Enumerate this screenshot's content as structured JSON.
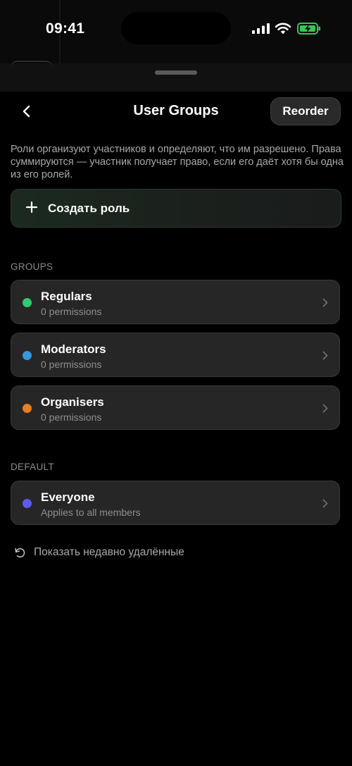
{
  "status_bar": {
    "time": "09:41"
  },
  "header": {
    "title": "User Groups",
    "reorder_label": "Reorder"
  },
  "description": "Роли организуют участников и определяют, что им разрешено. Права суммируются — участник получает право, если его даёт хотя бы одна из его ролей.",
  "create_role_label": "Создать роль",
  "sections": {
    "groups_title": "GROUPS",
    "default_title": "DEFAULT"
  },
  "groups": [
    {
      "name": "Regulars",
      "subtitle": "0 permissions",
      "color": "#2ecc71"
    },
    {
      "name": "Moderators",
      "subtitle": "0 permissions",
      "color": "#3498db"
    },
    {
      "name": "Organisers",
      "subtitle": "0 permissions",
      "color": "#e67e22"
    }
  ],
  "default_group": {
    "name": "Everyone",
    "subtitle": "Applies to all members",
    "color": "#5b5bf0"
  },
  "show_deleted_label": "Показать недавно удалённые",
  "colors": {
    "battery": "#34c759",
    "create_border": "#2f3a33"
  },
  "icons": {
    "back": "chevron-left-icon",
    "plus": "plus-icon",
    "chevron": "chevron-right-icon",
    "restore": "restore-icon"
  }
}
